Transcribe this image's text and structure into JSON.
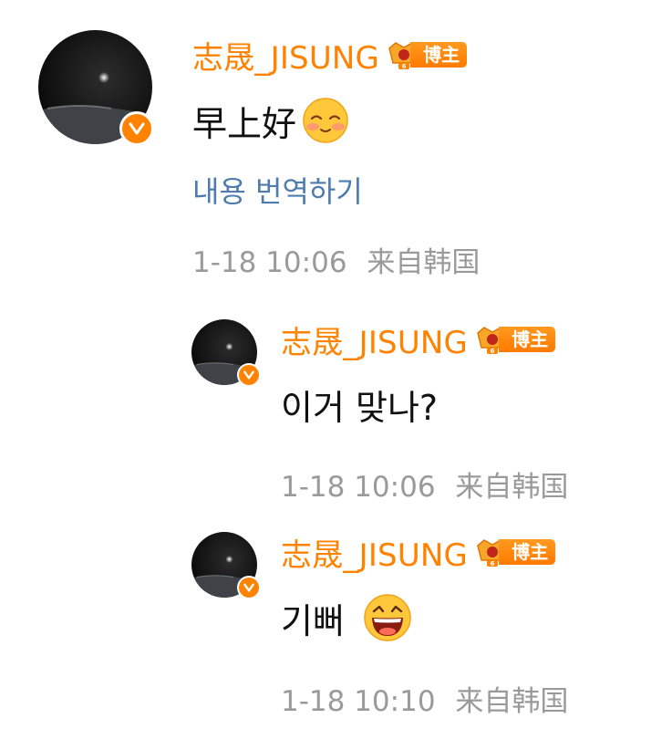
{
  "comments": [
    {
      "username": "志晟_JISUNG",
      "badge_label": "博主",
      "badge_level": "6",
      "text": "早上好",
      "emoji": "shy-smile-emoji",
      "translate_label": "내용 번역하기",
      "time": "1-18 10:06",
      "source": "来自韩国"
    },
    {
      "username": "志晟_JISUNG",
      "badge_label": "博主",
      "badge_level": "6",
      "text": "이거 맞나?",
      "time": "1-18 10:06",
      "source": "来自韩国"
    },
    {
      "username": "志晟_JISUNG",
      "badge_label": "博主",
      "badge_level": "6",
      "text": "기뻐",
      "emoji": "laughing-emoji",
      "time": "1-18 10:10",
      "source": "来自韩国"
    }
  ],
  "colors": {
    "username": "#ff8200",
    "verified": "#ff8200",
    "translate_link": "#4f7cae",
    "meta": "#9a9a9a"
  }
}
